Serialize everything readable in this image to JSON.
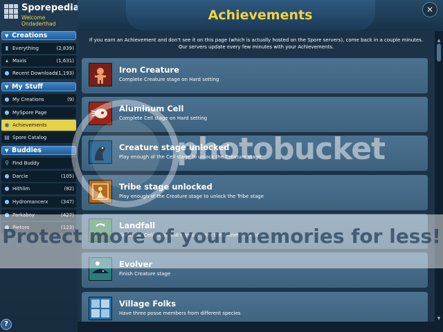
{
  "app": {
    "title": "Sporepedia",
    "trademark": "TM",
    "welcome": "Welcome Ondaderthad"
  },
  "colors": {
    "accent_yellow": "#f2d243",
    "section_blue": "#2b6fb2",
    "card_blue": "#45698a",
    "background": "#1c3347"
  },
  "sidebar": {
    "creations": {
      "label": "Creations",
      "items": [
        {
          "label": "Everything",
          "count": "(2,839)",
          "icon": "monitor-icon"
        },
        {
          "label": "Maxis",
          "count": "(1,631)",
          "icon": "maxis-icon"
        },
        {
          "label": "Recent Downloads",
          "count": "(1,193)",
          "icon": "person-icon"
        }
      ]
    },
    "mystuff": {
      "label": "My Stuff",
      "items": [
        {
          "label": "My Creations",
          "count": "(9)",
          "icon": "person-icon"
        },
        {
          "label": "MySpore Page",
          "count": "",
          "icon": "person-icon"
        },
        {
          "label": "Achievements",
          "count": "",
          "icon": "achievement-icon",
          "active": true
        },
        {
          "label": "Spore Catalog",
          "count": "",
          "icon": "catalog-icon"
        }
      ]
    },
    "buddies": {
      "label": "Buddies",
      "items": [
        {
          "label": "Find Buddy",
          "count": "",
          "icon": "search-icon"
        },
        {
          "label": "Darcie",
          "count": "(105)",
          "icon": "person-icon"
        },
        {
          "label": "Hithlim",
          "count": "(82)",
          "icon": "person-icon"
        },
        {
          "label": "Hydromancerx",
          "count": "(347)",
          "icon": "person-icon"
        },
        {
          "label": "Parkaboy",
          "count": "(427)",
          "icon": "person-icon"
        },
        {
          "label": "Pietoro",
          "count": "(123)",
          "icon": "person-icon"
        }
      ]
    },
    "help_label": "?"
  },
  "header": {
    "title": "Achievements",
    "close_label": "✕"
  },
  "notice": {
    "line1": "If you earn an Achievement and don't see it on this page (which is actually hosted on the Spore servers), come back in a couple minutes.",
    "line2": "Our servers update every few minutes with your Achievements."
  },
  "achievements": [
    {
      "name": "Iron Creature",
      "description": "Complete Creature stage on Hard setting",
      "icon": "iron-creature-icon"
    },
    {
      "name": "Aluminum Cell",
      "description": "Complete Cell stage on Hard setting",
      "icon": "aluminum-cell-icon"
    },
    {
      "name": "Creature stage unlocked",
      "description": "Play enough of the Cell stage to unlock the Creature stage",
      "icon": "creature-stage-icon"
    },
    {
      "name": "Tribe stage unlocked",
      "description": "Play enough of the Creature stage to unlock the Tribe stage",
      "icon": "tribe-stage-icon"
    },
    {
      "name": "Landfall",
      "description": "Finish the Cell stage and clamber onto the planet's surface",
      "icon": "landfall-icon"
    },
    {
      "name": "Evolver",
      "description": "Finish Creature stage",
      "icon": "evolver-icon"
    },
    {
      "name": "Village Folks",
      "description": "Have three posse members from different species",
      "icon": "village-folks-icon"
    }
  ],
  "watermark": {
    "brand": "photobucket",
    "protect": "Protect more of your memories for less!"
  }
}
